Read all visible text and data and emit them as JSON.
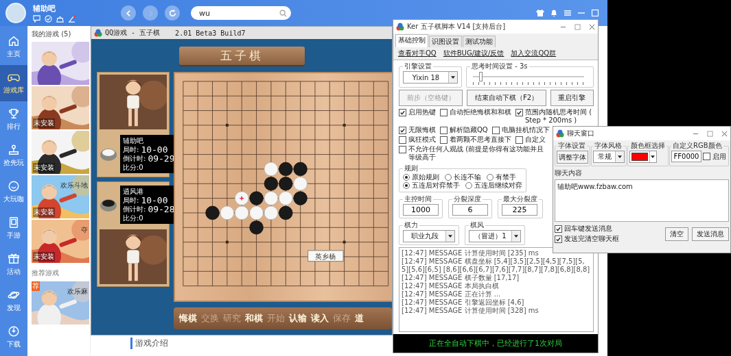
{
  "client": {
    "username": "辅助吧",
    "search": {
      "value": "wu"
    },
    "nav": [
      {
        "kind": "home",
        "label": "主页",
        "selected": false
      },
      {
        "kind": "games",
        "label": "游戏库",
        "selected": true
      },
      {
        "kind": "rank",
        "label": "排行",
        "selected": false
      },
      {
        "kind": "early",
        "label": "抢先玩",
        "selected": false
      },
      {
        "kind": "fun",
        "label": "大玩咖",
        "selected": false
      },
      {
        "kind": "mobile",
        "label": "手游",
        "selected": false
      },
      {
        "kind": "gift",
        "label": "活动",
        "selected": false
      },
      {
        "kind": "discover",
        "label": "发现",
        "selected": false
      },
      {
        "kind": "download",
        "label": "下载",
        "selected": false
      }
    ],
    "my_games": {
      "title": "我的游戏 (5)",
      "games": [
        {
          "kind": "picture"
        },
        {
          "kind": "picture",
          "badge": "未安装"
        },
        {
          "kind": "picture",
          "badge": "未安装"
        },
        {
          "kind": "picture",
          "name": "欢乐斗地",
          "badge": "未安装"
        },
        {
          "kind": "picture",
          "name": "夺",
          "badge": "未安装"
        }
      ]
    },
    "recommended": {
      "title": "推荐游戏",
      "games": [
        {
          "kind": "picture",
          "name": "欢乐麻",
          "badge": "荐"
        }
      ]
    },
    "intro_heading": "游戏介绍"
  },
  "gomoku": {
    "title": "QQ游戏 - 五子棋",
    "version": "2.01 Beta3 Build7",
    "banner": "五子棋",
    "players": [
      {
        "kind": "white",
        "name": "辅助吧",
        "time_label": "局时:",
        "time": "10-00",
        "countdown_label": "倒计时:",
        "countdown": "09-29",
        "score": "比分:0"
      },
      {
        "kind": "black",
        "name": "逍风港",
        "time_label": "局时:",
        "time": "10-00",
        "countdown_label": "倒计时:",
        "countdown": "09-28",
        "score": "比分:0"
      }
    ],
    "board_rows": [
      {
        "cells": [
          {
            "kind": "empty"
          },
          {
            "kind": "empty"
          },
          {
            "kind": "empty"
          },
          {
            "kind": "empty"
          },
          {
            "kind": "empty"
          },
          {
            "kind": "empty"
          },
          {
            "kind": "empty"
          },
          {
            "kind": "empty"
          },
          {
            "kind": "empty"
          }
        ]
      },
      {
        "cells": [
          {
            "kind": "empty"
          },
          {
            "kind": "empty"
          },
          {
            "kind": "empty"
          },
          {
            "kind": "empty"
          },
          {
            "kind": "empty"
          },
          {
            "kind": "empty"
          },
          {
            "kind": "empty"
          },
          {
            "kind": "empty"
          },
          {
            "kind": "empty"
          }
        ]
      },
      {
        "cells": [
          {
            "kind": "empty"
          },
          {
            "kind": "empty"
          },
          {
            "kind": "empty"
          },
          {
            "kind": "empty"
          },
          {
            "kind": "empty"
          },
          {
            "kind": "empty"
          },
          {
            "kind": "empty"
          },
          {
            "kind": "empty"
          },
          {
            "kind": "empty"
          }
        ]
      },
      {
        "cells": [
          {
            "kind": "empty"
          },
          {
            "kind": "empty"
          },
          {
            "kind": "empty"
          },
          {
            "kind": "empty"
          },
          {
            "kind": "empty"
          },
          {
            "kind": "empty"
          },
          {
            "kind": "empty"
          },
          {
            "kind": "empty"
          },
          {
            "kind": "empty"
          }
        ]
      },
      {
        "cells": [
          {
            "kind": "empty"
          },
          {
            "kind": "empty"
          },
          {
            "kind": "empty"
          },
          {
            "kind": "empty"
          },
          {
            "kind": "empty"
          },
          {
            "kind": "empty"
          },
          {
            "kind": "empty"
          },
          {
            "kind": "empty"
          },
          {
            "kind": "empty"
          }
        ]
      },
      {
        "cells": [
          {
            "kind": "empty"
          },
          {
            "kind": "empty"
          },
          {
            "kind": "empty"
          },
          {
            "kind": "empty"
          },
          {
            "kind": "empty"
          },
          {
            "kind": "empty"
          },
          {
            "kind": "empty"
          },
          {
            "kind": "empty"
          },
          {
            "kind": "empty"
          }
        ]
      },
      {
        "cells": [
          {
            "kind": "empty"
          },
          {
            "kind": "empty"
          },
          {
            "kind": "empty"
          },
          {
            "kind": "empty"
          },
          {
            "kind": "empty"
          },
          {
            "kind": "empty"
          },
          {
            "kind": "white"
          },
          {
            "kind": "black"
          },
          {
            "kind": "black"
          }
        ]
      },
      {
        "cells": [
          {
            "kind": "empty"
          },
          {
            "kind": "empty"
          },
          {
            "kind": "empty"
          },
          {
            "kind": "empty"
          },
          {
            "kind": "empty"
          },
          {
            "kind": "empty"
          },
          {
            "kind": "black"
          },
          {
            "kind": "black"
          },
          {
            "kind": "white"
          }
        ]
      },
      {
        "cells": [
          {
            "kind": "empty"
          },
          {
            "kind": "empty"
          },
          {
            "kind": "empty"
          },
          {
            "kind": "empty"
          },
          {
            "kind": "white",
            "last": true
          },
          {
            "kind": "black"
          },
          {
            "kind": "white"
          },
          {
            "kind": "white"
          },
          {
            "kind": "black"
          }
        ]
      },
      {
        "cells": [
          {
            "kind": "empty"
          },
          {
            "kind": "empty"
          },
          {
            "kind": "black"
          },
          {
            "kind": "white"
          },
          {
            "kind": "white"
          },
          {
            "kind": "white"
          },
          {
            "kind": "white"
          },
          {
            "kind": "black"
          },
          {
            "kind": "empty"
          }
        ]
      },
      {
        "cells": [
          {
            "kind": "empty"
          },
          {
            "kind": "empty"
          },
          {
            "kind": "empty"
          },
          {
            "kind": "empty"
          },
          {
            "kind": "empty"
          },
          {
            "kind": "black"
          },
          {
            "kind": "empty"
          },
          {
            "kind": "empty"
          },
          {
            "kind": "empty"
          }
        ]
      }
    ],
    "sign": "英乡杨",
    "actions": [
      {
        "label": "悔棋",
        "disabled": false
      },
      {
        "label": "交换",
        "disabled": true
      },
      {
        "label": "研究",
        "disabled": true
      },
      {
        "label": "和棋",
        "disabled": false
      },
      {
        "label": "开始",
        "disabled": true
      },
      {
        "label": "认输",
        "disabled": false
      },
      {
        "label": "读入",
        "disabled": false
      },
      {
        "label": "保存",
        "disabled": true
      },
      {
        "label": "道",
        "disabled": false
      }
    ]
  },
  "ker": {
    "title": "Ker 五子棋脚本 V14 [支持后台]",
    "tabs": [
      {
        "label": "基础控制",
        "selected": true
      },
      {
        "label": "识图设置",
        "selected": false
      },
      {
        "label": "测试功能",
        "selected": false
      }
    ],
    "links": [
      "查看对手QQ",
      "软件BUG/建议/反馈",
      "加入交流QQ群"
    ],
    "engine": {
      "label": "引擎设置",
      "value": "Yixin 18"
    },
    "think": {
      "label": "思考时间设置 - 3s",
      "level": 0.07
    },
    "buttons": [
      {
        "label": "前步（空格键）",
        "disabled": true
      },
      {
        "label": "结束自动下棋（F2）",
        "disabled": false
      },
      {
        "label": "重启引擎",
        "disabled": false
      }
    ],
    "option_rows": [
      {
        "options": [
          {
            "label": "启用热键",
            "checked": true
          },
          {
            "label": "自动拒绝悔棋和和棋",
            "checked": false
          },
          {
            "label": "范围内随机思考时间 ( Step * 200ms )",
            "checked": true
          }
        ]
      },
      {
        "options": [
          {
            "label": "无限悔棋",
            "checked": true
          },
          {
            "label": "解析隐藏QQ",
            "checked": false
          },
          {
            "label": "电脑挂机情况下",
            "checked": false
          }
        ]
      },
      {
        "options": [
          {
            "label": "疯狂模式",
            "checked": false
          },
          {
            "label": "着两颗不思考直接下",
            "checked": false
          },
          {
            "label": "自定义",
            "checked": false
          }
        ]
      },
      {
        "options": [
          {
            "label": "不允许任何人观战 (前提是你得有这功能并且等级高于",
            "checked": false
          }
        ]
      }
    ],
    "rules": {
      "label": "规则",
      "rows": [
        {
          "options": [
            {
              "label": "原始规则",
              "selected": true
            },
            {
              "label": "长连不输",
              "selected": false
            },
            {
              "label": "有禁手",
              "selected": false
            }
          ]
        },
        {
          "options": [
            {
              "label": "五连后对弈禁手",
              "selected": true
            },
            {
              "label": "五连后继续对弈",
              "selected": false
            }
          ]
        }
      ]
    },
    "numbers": [
      {
        "label": "主控时间",
        "value": "1000"
      },
      {
        "label": "分裂深度",
        "value": "6"
      },
      {
        "label": "最大分裂度",
        "value": "225"
      }
    ],
    "selects": [
      {
        "label": "棋力",
        "value": "职业九段"
      },
      {
        "label": "棋风",
        "value": "（冒进）1"
      }
    ],
    "log": [
      "[12:47] MESSAGE 计算使用时间 [235] ms",
      "[12:47] MESSAGE 棋盘坐标 [5,4][3,5][2,5][4,5][7,5][5,5][5,6][6,5] [8,6][6,6][6,7][7,6][7,7][8,7][7,8][6,8][8,8]",
      "[12:47] MESSAGE 棋子数量 [17,17]",
      "[12:47] MESSAGE 本局执白棋",
      "[12:47] MESSAGE 正在计算 ...",
      "[12:47] MESSAGE 引擎返回坐标 [4,6]",
      "[12:47] MESSAGE 计算使用时间 [328] ms"
    ],
    "status": "正在全自动下棋中，已经进行了1次对局"
  },
  "chat": {
    "title": "聊天窗口",
    "font": {
      "label": "字体设置",
      "button": "调整字体"
    },
    "style": {
      "label": "字体风格",
      "value": "常规"
    },
    "color": {
      "label": "颜色框选择",
      "color": "#ff0000"
    },
    "rgb": {
      "label": "自定义RGB颜色",
      "value": "FF0000",
      "enable": {
        "label": "启用",
        "checked": false
      }
    },
    "content": {
      "label": "聊天内容",
      "value": "辅助吧www.fzbaw.com"
    },
    "options": [
      {
        "label": "回车键发送消息",
        "checked": true
      },
      {
        "label": "发送完清空聊天框",
        "checked": true
      }
    ],
    "buttons": [
      "清空",
      "发送消息"
    ]
  }
}
